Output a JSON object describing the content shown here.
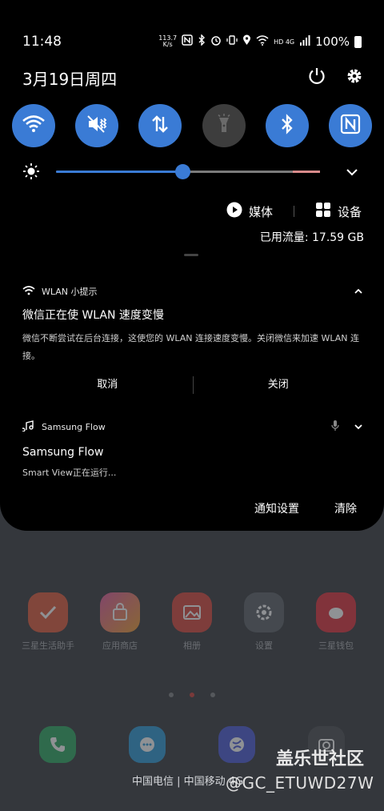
{
  "status_bar": {
    "time": "11:48",
    "net_speed_value": "113.7",
    "net_speed_unit": "K/s",
    "network_label": "HD 4G",
    "battery": "100%",
    "icons": [
      "nfc-icon",
      "bluetooth-icon",
      "alarm-icon",
      "vibrate-icon",
      "location-icon",
      "wifi-icon",
      "signal-icon",
      "battery-icon"
    ]
  },
  "header": {
    "date": "3月19日周四",
    "power_icon": "power-icon",
    "settings_icon": "gear-icon"
  },
  "quick_tiles": [
    {
      "name": "wifi",
      "icon": "wifi-icon",
      "on": true
    },
    {
      "name": "sound",
      "icon": "mute-vibrate-icon",
      "on": true
    },
    {
      "name": "mobile-data",
      "icon": "data-arrows-icon",
      "on": true
    },
    {
      "name": "flashlight",
      "icon": "flashlight-icon",
      "on": false
    },
    {
      "name": "bluetooth",
      "icon": "bluetooth-icon",
      "on": true
    },
    {
      "name": "nfc",
      "icon": "nfc-icon",
      "on": true
    }
  ],
  "brightness": {
    "level": 0.48,
    "icon": "sun-icon"
  },
  "media_row": {
    "media_label": "媒体",
    "devices_label": "设备"
  },
  "data_usage": "已用流量: 17.59 GB",
  "notifications": [
    {
      "app": "WLAN 小提示",
      "title": "微信正在使 WLAN 速度变慢",
      "body": "微信不断尝试在后台连接，这使您的 WLAN 连接速度变慢。关闭微信来加速 WLAN 连接。",
      "actions": [
        "取消",
        "关闭"
      ]
    },
    {
      "app": "Samsung Flow",
      "title": "Samsung Flow",
      "body": "Smart View正在运行..."
    }
  ],
  "footer": {
    "notification_settings": "通知设置",
    "clear": "清除"
  },
  "home_screen": {
    "apps": [
      "三星生活助手",
      "应用商店",
      "相册",
      "设置",
      "三星钱包"
    ],
    "carrier": "中国电信 | 中国移动 4G"
  },
  "watermark": {
    "brand": "盖乐世社区",
    "user": "@GC_ETUWD27W"
  },
  "colors": {
    "accent": "#3a7bd5",
    "shade_bg": "#000000",
    "tile_off": "#3d3d3d"
  }
}
